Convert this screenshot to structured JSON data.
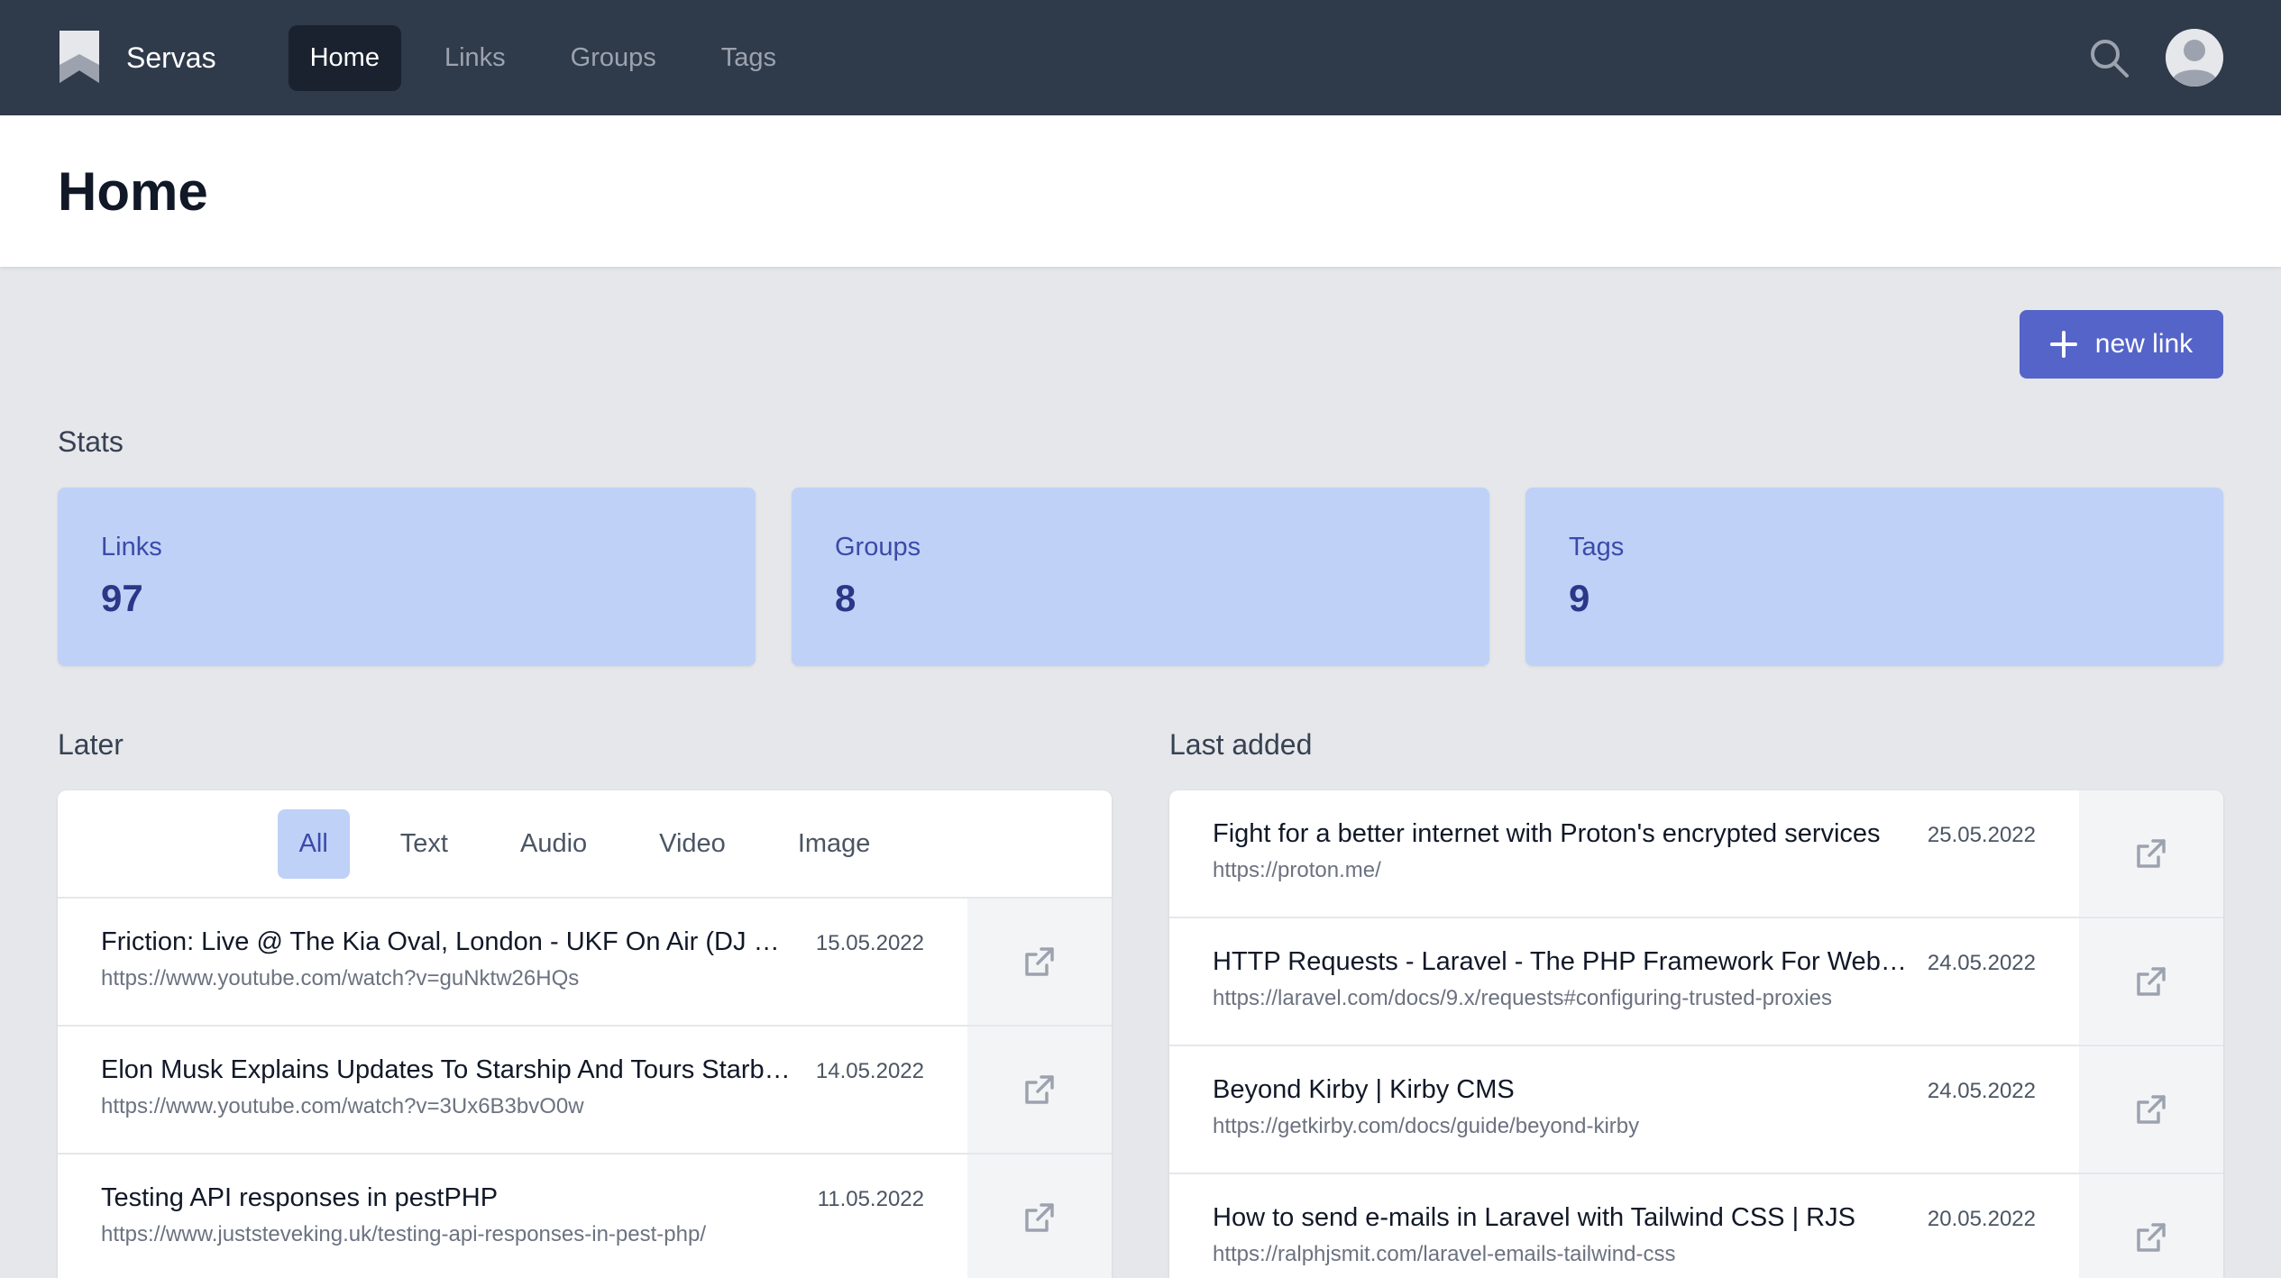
{
  "nav": {
    "brand": "Servas",
    "links": [
      {
        "label": "Home",
        "active": true
      },
      {
        "label": "Links",
        "active": false
      },
      {
        "label": "Groups",
        "active": false
      },
      {
        "label": "Tags",
        "active": false
      }
    ]
  },
  "header": {
    "title": "Home"
  },
  "actions": {
    "new_link_label": "new link"
  },
  "stats": {
    "heading": "Stats",
    "items": [
      {
        "label": "Links",
        "value": "97"
      },
      {
        "label": "Groups",
        "value": "8"
      },
      {
        "label": "Tags",
        "value": "9"
      }
    ]
  },
  "later": {
    "heading": "Later",
    "filters": [
      "All",
      "Text",
      "Audio",
      "Video",
      "Image"
    ],
    "active_filter": "All",
    "links": [
      {
        "title": "Friction: Live @ The Kia Oval, London - UKF On Air (DJ Set)",
        "url": "https://www.youtube.com/watch?v=guNktw26HQs",
        "date": "15.05.2022"
      },
      {
        "title": "Elon Musk Explains Updates To Starship And Tours Starbase",
        "url": "https://www.youtube.com/watch?v=3Ux6B3bvO0w",
        "date": "14.05.2022"
      },
      {
        "title": "Testing API responses in pestPHP",
        "url": "https://www.juststeveking.uk/testing-api-responses-in-pest-php/",
        "date": "11.05.2022"
      }
    ]
  },
  "last_added": {
    "heading": "Last added",
    "links": [
      {
        "title": "Fight for a better internet with Proton's encrypted services",
        "url": "https://proton.me/",
        "date": "25.05.2022"
      },
      {
        "title": "HTTP Requests - Laravel - The PHP Framework For Web Artisans",
        "url": "https://laravel.com/docs/9.x/requests#configuring-trusted-proxies",
        "date": "24.05.2022"
      },
      {
        "title": "Beyond Kirby | Kirby CMS",
        "url": "https://getkirby.com/docs/guide/beyond-kirby",
        "date": "24.05.2022"
      },
      {
        "title": "How to send e-mails in Laravel with Tailwind CSS | RJS",
        "url": "https://ralphjsmit.com/laravel-emails-tailwind-css",
        "date": "20.05.2022"
      }
    ]
  },
  "colors": {
    "navbar": "#2f3a4a",
    "accent": "#5564c8",
    "stat_card": "#bfd1f7",
    "background": "#e5e7eb"
  },
  "icons": [
    "bookmark-logo-icon",
    "search-icon",
    "user-avatar-icon",
    "plus-icon",
    "external-link-icon"
  ]
}
